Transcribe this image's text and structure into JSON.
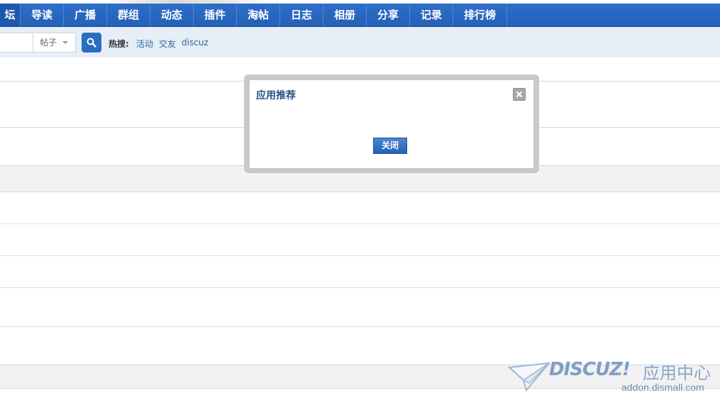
{
  "nav": {
    "items": [
      {
        "label": "坛",
        "active": true
      },
      {
        "label": "导读"
      },
      {
        "label": "广播"
      },
      {
        "label": "群组"
      },
      {
        "label": "动态"
      },
      {
        "label": "插件"
      },
      {
        "label": "淘帖"
      },
      {
        "label": "日志"
      },
      {
        "label": "相册"
      },
      {
        "label": "分享"
      },
      {
        "label": "记录"
      },
      {
        "label": "排行榜"
      }
    ]
  },
  "search": {
    "input_value": "",
    "type_selected": "帖子",
    "button_icon": "search-icon",
    "hot_label": "热搜:",
    "hot_links": [
      "活动",
      "交友",
      "discuz"
    ]
  },
  "dialog": {
    "title": "应用推荐",
    "close_icon": "close-icon",
    "ok_label": "关闭"
  },
  "watermark": {
    "brand": "DISCUZ!",
    "sub": "应用中心",
    "domain": "addon.dismall.com"
  },
  "colors": {
    "nav_bg": "#2a68c0",
    "searchbar_bg": "#e6eef7",
    "dialog_title": "#2c5287",
    "link": "#336699"
  }
}
